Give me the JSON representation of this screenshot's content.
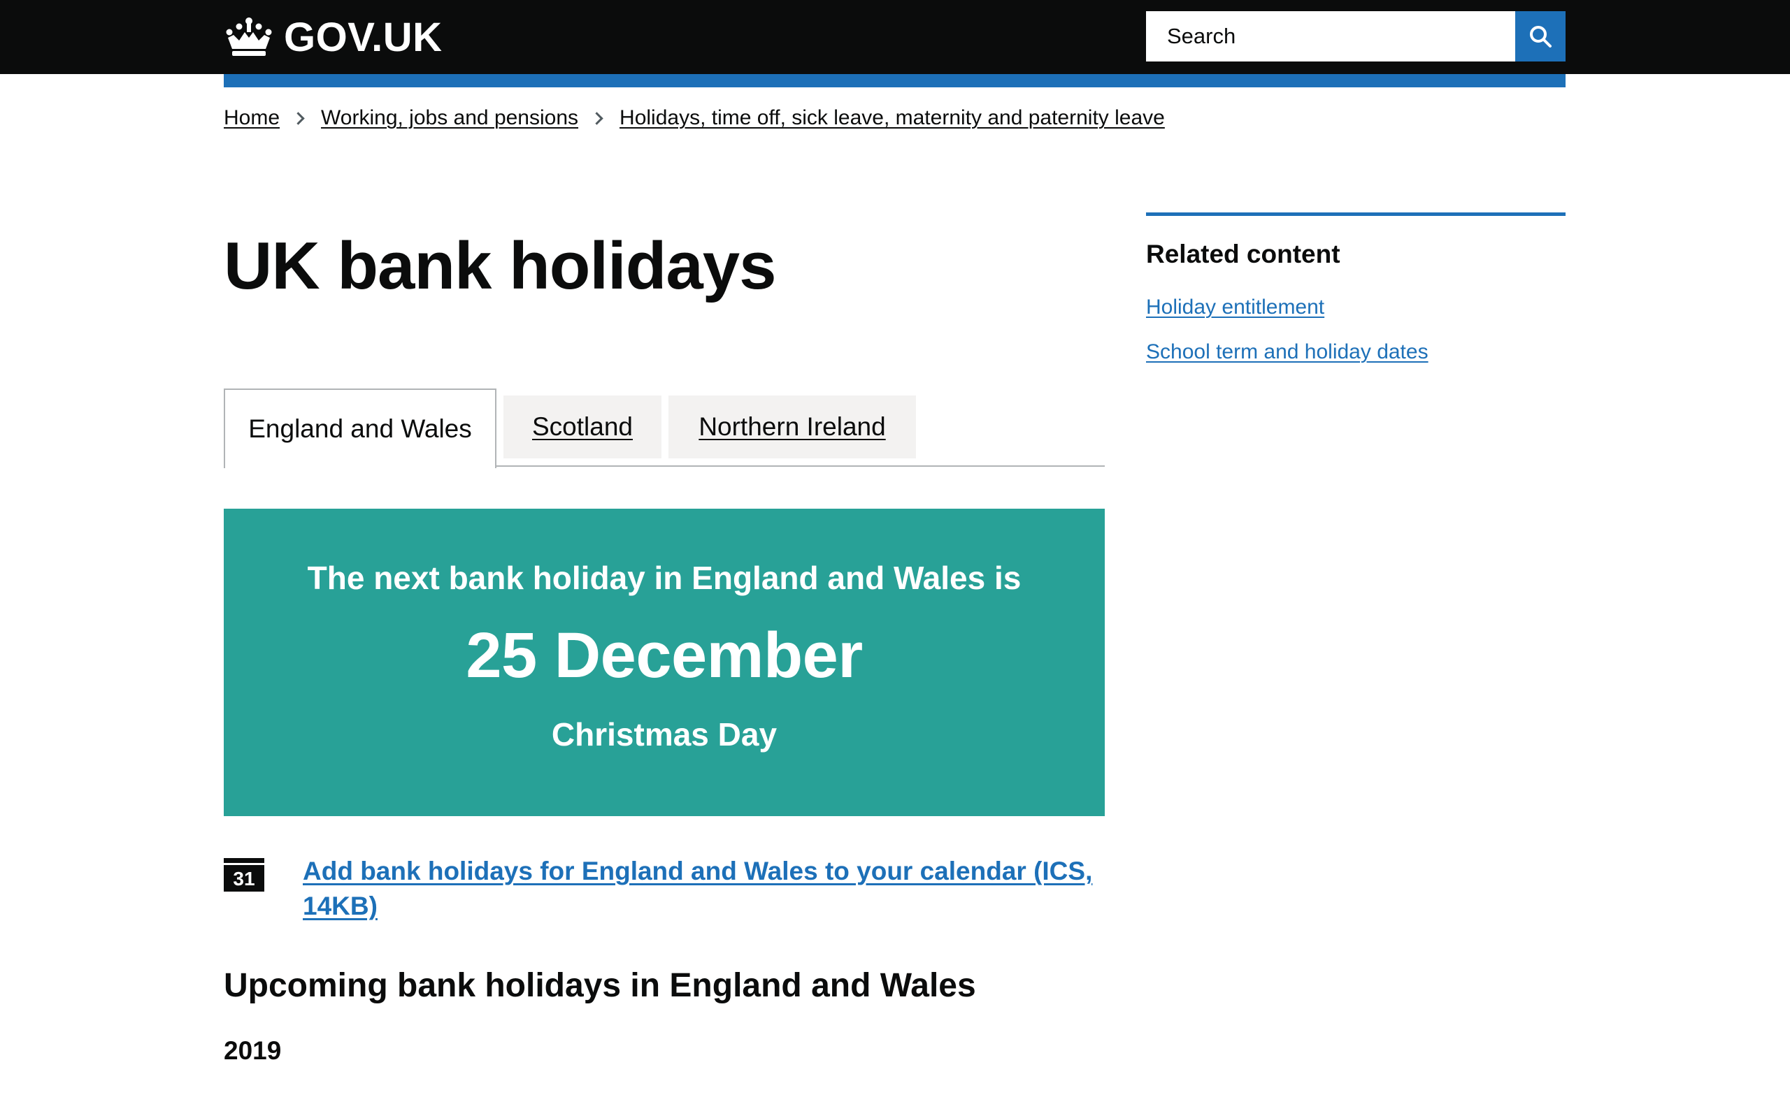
{
  "header": {
    "logo_text": "GOV.UK",
    "search_placeholder": "Search",
    "icons": {
      "logo": "crown-icon",
      "search": "search-icon"
    }
  },
  "breadcrumbs": [
    "Home",
    "Working, jobs and pensions",
    "Holidays, time off, sick leave, maternity and paternity leave"
  ],
  "page_title": "UK bank holidays",
  "related": {
    "heading": "Related content",
    "links": [
      "Holiday entitlement",
      "School term and holiday dates"
    ]
  },
  "tabs": [
    {
      "label": "England and Wales",
      "active": true
    },
    {
      "label": "Scotland",
      "active": false
    },
    {
      "label": "Northern Ireland",
      "active": false
    }
  ],
  "banner": {
    "intro": "The next bank holiday in England and Wales is",
    "date": "25 December",
    "name": "Christmas Day"
  },
  "calendar": {
    "icon_number": "31",
    "icon": "calendar-icon",
    "link_text": "Add bank holidays for England and Wales to your calendar (ICS, 14KB)"
  },
  "upcoming_heading": "Upcoming bank holidays in England and Wales",
  "year": "2019",
  "colors": {
    "header_bg": "#0b0c0c",
    "brand_blue": "#1d70b8",
    "banner_green": "#28a197",
    "tab_bg": "#f3f2f1",
    "text": "#0b0c0c"
  }
}
